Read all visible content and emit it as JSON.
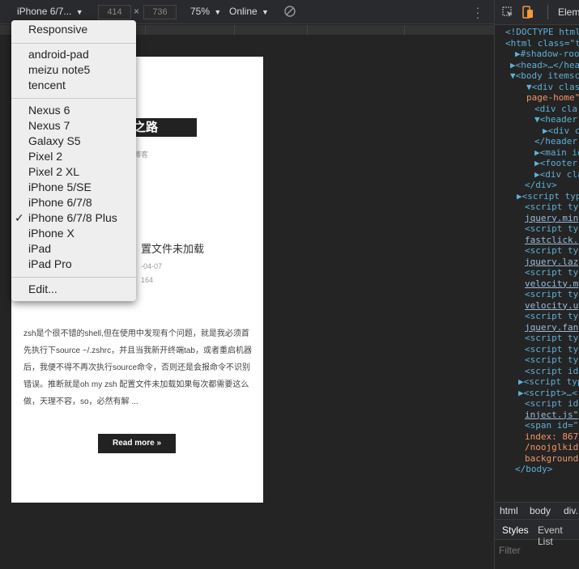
{
  "toolbar": {
    "device": "iPhone 6/7...",
    "width": "414",
    "height": "736",
    "times": "×",
    "zoom": "75%",
    "network": "Online",
    "caret": "▼"
  },
  "menu": {
    "items": [
      {
        "label": "Responsive"
      },
      {
        "label": "android-pad"
      },
      {
        "label": "meizu note5"
      },
      {
        "label": "tencent"
      },
      {
        "label": "Nexus 6"
      },
      {
        "label": "Nexus 7"
      },
      {
        "label": "Galaxy S5"
      },
      {
        "label": "Pixel 2"
      },
      {
        "label": "Pixel 2 XL"
      },
      {
        "label": "iPhone 5/SE"
      },
      {
        "label": "iPhone 6/7/8"
      },
      {
        "label": "iPhone 6/7/8 Plus",
        "checked": true
      },
      {
        "label": "iPhone X"
      },
      {
        "label": "iPad"
      },
      {
        "label": "iPad Pro"
      },
      {
        "label": "Edit..."
      }
    ],
    "check_mark": "✓"
  },
  "page": {
    "site_title": "之路",
    "site_subtitle": "博客",
    "post_title": "置文件未加载",
    "post_date": "-04-07",
    "post_views": "164",
    "body": "zsh是个很不错的shell,但在使用中发现有个问题，就是我必须首先执行下source ~/.zshrc，并且当我新开终端tab，或者重启机器后，我便不得不再次执行source命令，否则还是会报命令不识别错误。推断就是oh my zsh 配置文件未加载如果每次都需要这么做，天理不容，so，必然有解 ...",
    "read_more": "Read more »"
  },
  "devtools": {
    "tab": "Eleme",
    "crumbs": [
      "html",
      "body",
      "div."
    ],
    "styles_tab": "Styles",
    "event_tab": "Event List",
    "filter": "Filter",
    "lines": [
      {
        "text": "<!DOCTYPE html"
      },
      {
        "text": "<html class=\"t"
      },
      {
        "text": "▶#shadow-root"
      },
      {
        "text": "▶<head>…</hea"
      },
      {
        "text": "▼<body itemsc"
      },
      {
        "text": "▼<div class"
      },
      {
        "text": "page-home\""
      },
      {
        "text": "<div cla"
      },
      {
        "text": "▼<header i"
      },
      {
        "text": "▶<div cl"
      },
      {
        "text": "</header"
      },
      {
        "text": "▶<main id="
      },
      {
        "text": "▶<footer i"
      },
      {
        "text": "▶<div cla"
      },
      {
        "text": "</div>"
      },
      {
        "text": "▶<script typ"
      },
      {
        "text": "<script ty"
      },
      {
        "text": "jquery.min"
      },
      {
        "text": "<script ty"
      },
      {
        "text": "fastclick."
      },
      {
        "text": "<script ty"
      },
      {
        "text": "jquery.laz"
      },
      {
        "text": "<script ty"
      },
      {
        "text": "velocity.m"
      },
      {
        "text": "<script ty"
      },
      {
        "text": "velocity.u"
      },
      {
        "text": "<script ty"
      },
      {
        "text": "jquery.fan"
      },
      {
        "text": "<script ty"
      },
      {
        "text": "<script ty"
      },
      {
        "text": "<script ty"
      },
      {
        "text": "<script id"
      },
      {
        "text": "▶<script typ"
      },
      {
        "text": "▶<script>…<"
      },
      {
        "text": "<script id"
      },
      {
        "text": "inject.js\""
      },
      {
        "text": "<span id=\""
      },
      {
        "text": "index: 867"
      },
      {
        "text": "/noojglkid"
      },
      {
        "text": "background"
      },
      {
        "text": "</body>"
      }
    ]
  }
}
